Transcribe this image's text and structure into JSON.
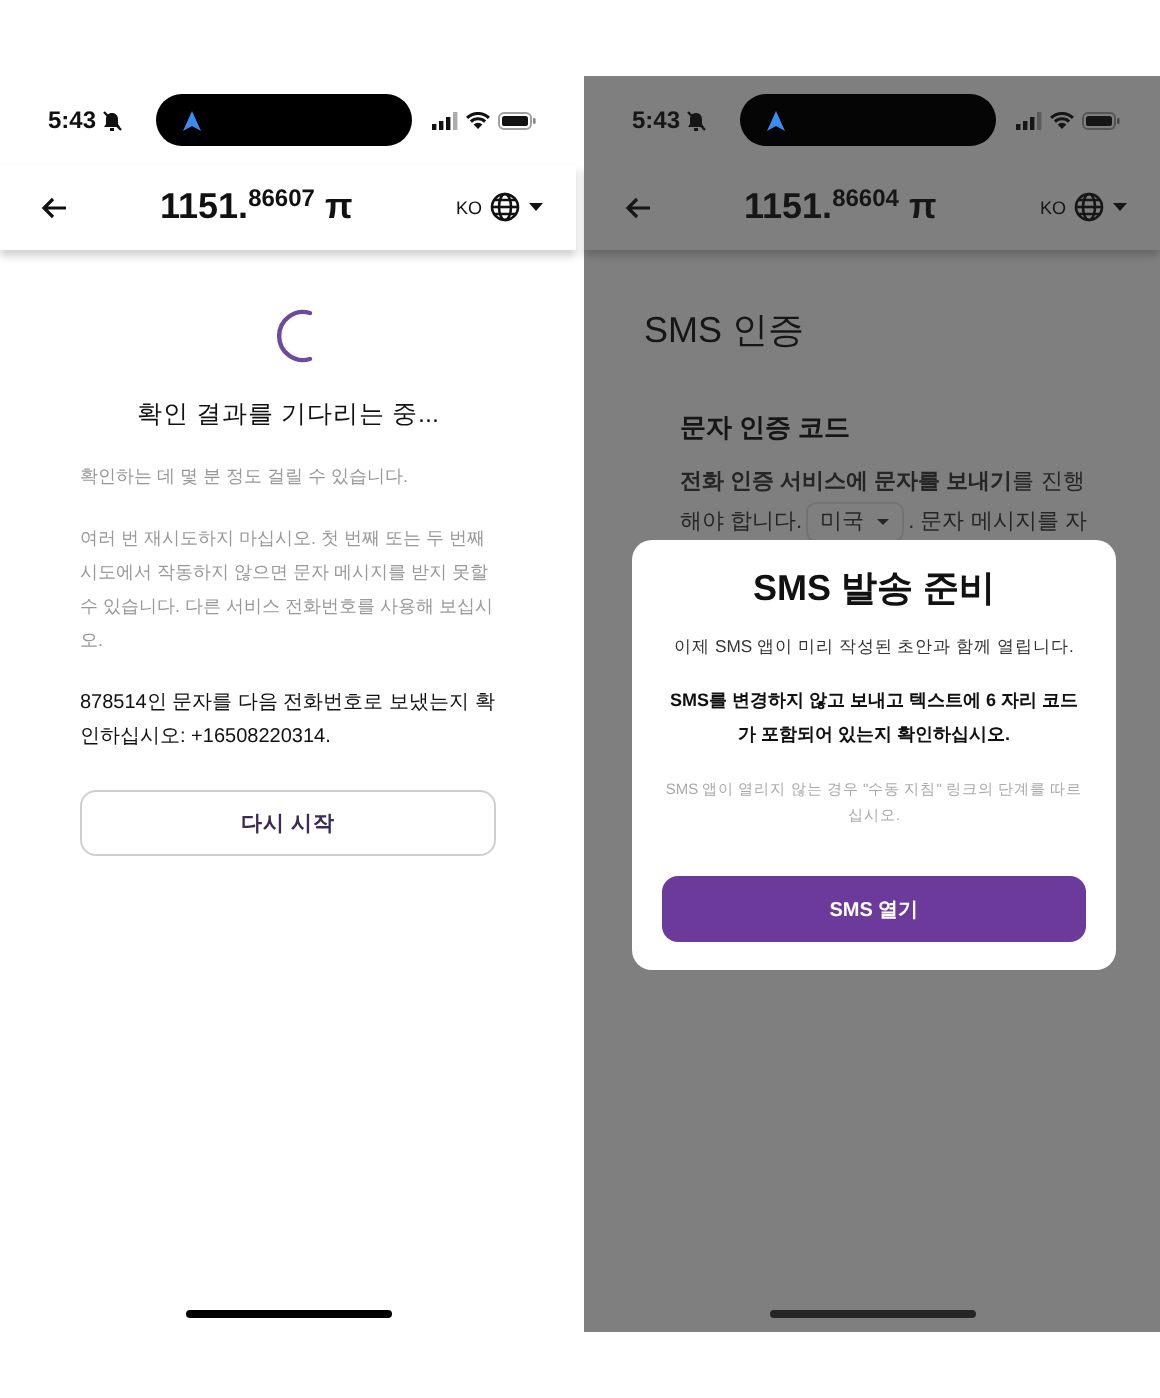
{
  "screens": [
    {
      "kind": "loading",
      "status_bar": {
        "time": "5:43"
      },
      "header": {
        "balance": "1151.$^{86607}$ π",
        "language": "KO"
      },
      "title": "확인 결과를 기다리는 중...",
      "hint": "확인하는 데 몇 분 정도 걸릴 수 있습니다.",
      "warning": "여러 번 재시도하지 마십시오. 첫 번째 또는 두 번째 시도에서 작동하지 않으면 문자 메시지를 받지 못할 수 있습니다. 다른 서비스 전화번호를 사용해 보십시오.",
      "instruction": "878514인 문자를 다음 전화번호로 보냈는지 확인하십시오: +16508220314.",
      "button": "다시 시작"
    },
    {
      "kind": "dialog",
      "status_bar": {
        "time": "5:43"
      },
      "header": {
        "balance": "1151.$^{86604}$ π",
        "language": "KO"
      },
      "page_title": "SMS 인증",
      "section_title": "문자 인증 코드",
      "body": "**전화 인증 서비스에 문자를 보내기**를 진행",
      "body_line_2": "해야 합니다.",
      "country_select": "미국",
      "body_tail": ". 문자 메시지를 자",
      "dialog": {
        "title": "SMS 발송 준비",
        "message": "이제 SMS 앱이 미리 작성된 초안과 함께 열립니다.",
        "emphasis": "SMS를 변경하지 않고 보내고 텍스트에 6 자리 코드가 포함되어 있는지 확인하십시오.",
        "note": "SMS 앱이 열리지 않는 경우 \"수동 지침\" 링크의 단계를 따르십시오.",
        "button": "SMS 열기"
      }
    }
  ]
}
